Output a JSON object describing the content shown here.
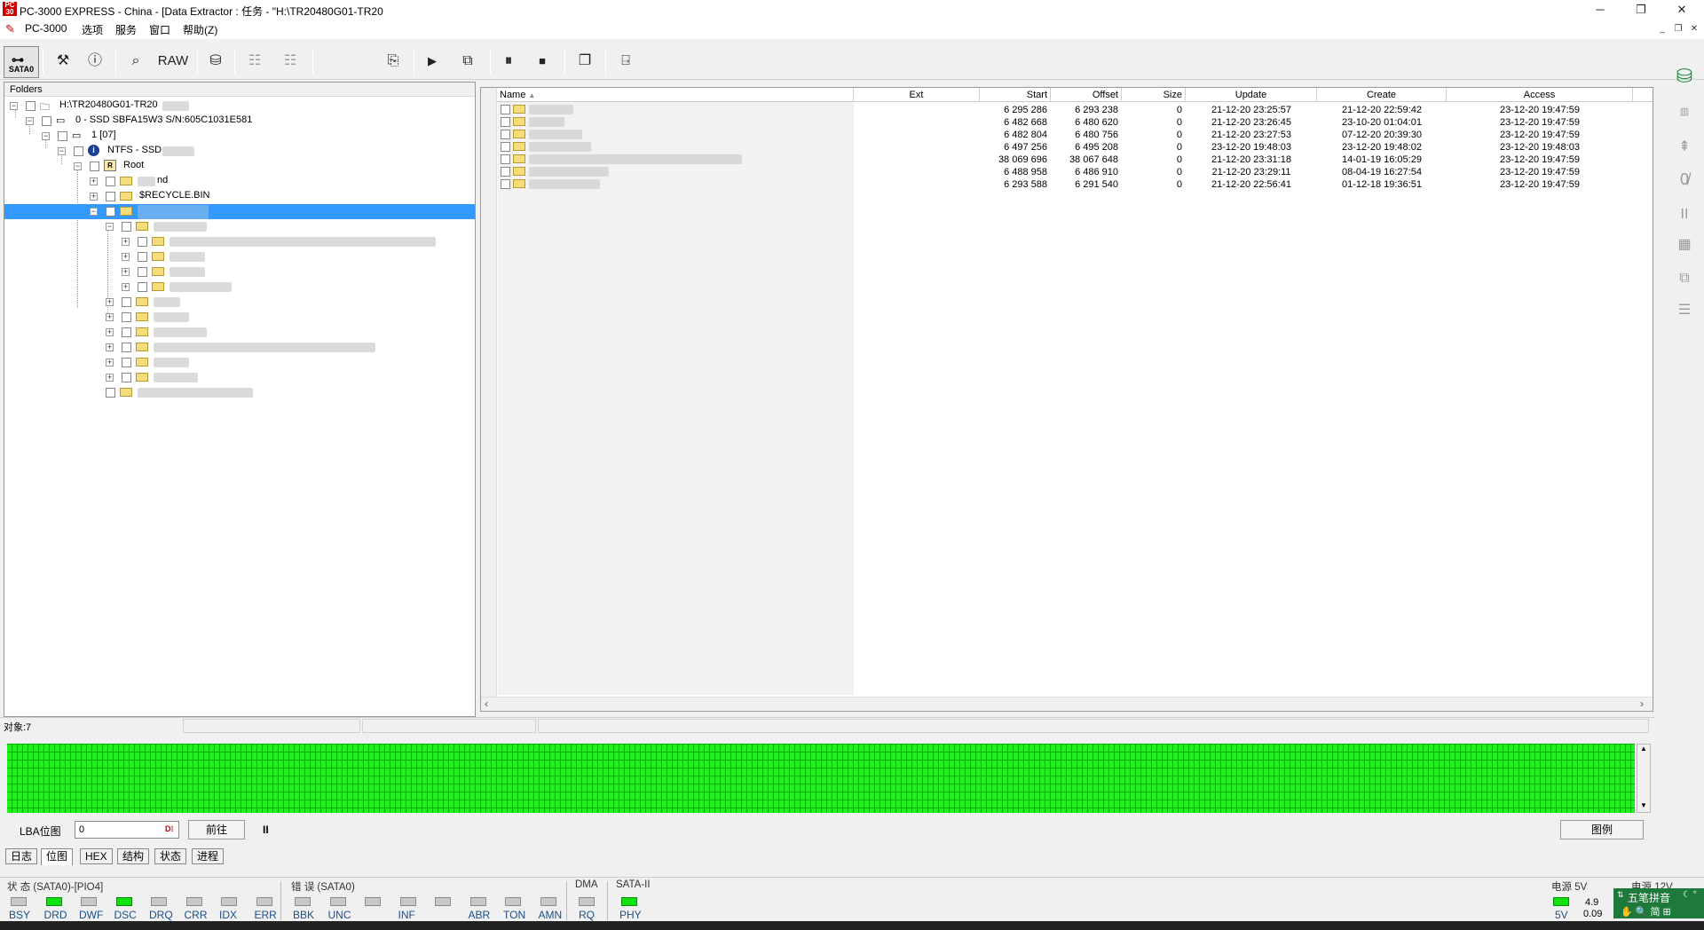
{
  "window": {
    "title": "PC-3000 EXPRESS - China - [Data Extractor : 任务 - \"H:\\TR20480G01-TR20",
    "controls": {
      "minimize": "─",
      "restore": "❐",
      "close": "✕"
    }
  },
  "menu": {
    "items": [
      "PC-3000",
      "选项",
      "服务",
      "窗口",
      "帮助(Z)"
    ],
    "mdi": {
      "minimize": "_",
      "restore": "❐",
      "close": "✕"
    }
  },
  "toolbar": {
    "sata_label": "SATA0",
    "raw_label": "RAW"
  },
  "tree": {
    "header": "Folders",
    "nodes": {
      "task": "H:\\TR20480G01-TR20",
      "device": "0 - SSD SBFA15W3 S/N:605C1031E581",
      "partition": "1 [07]",
      "fs": "NTFS - SSD",
      "root": "Root",
      "child1": "nd",
      "child2": "$RECYCLE.BIN"
    }
  },
  "list": {
    "columns": [
      "Name",
      "Ext",
      "Start",
      "Offset",
      "Size",
      "Update",
      "Create",
      "Access"
    ],
    "rows": [
      {
        "start": "6 295 286",
        "offset": "6 293 238",
        "size": "0",
        "update": "21-12-20 23:25:57",
        "create": "21-12-20 22:59:42",
        "access": "23-12-20 19:47:59"
      },
      {
        "start": "6 482 668",
        "offset": "6 480 620",
        "size": "0",
        "update": "21-12-20 23:26:45",
        "create": "23-10-20 01:04:01",
        "access": "23-12-20 19:47:59"
      },
      {
        "start": "6 482 804",
        "offset": "6 480 756",
        "size": "0",
        "update": "21-12-20 23:27:53",
        "create": "07-12-20 20:39:30",
        "access": "23-12-20 19:47:59"
      },
      {
        "start": "6 497 256",
        "offset": "6 495 208",
        "size": "0",
        "update": "23-12-20 19:48:03",
        "create": "23-12-20 19:48:02",
        "access": "23-12-20 19:48:03"
      },
      {
        "start": "38 069 696",
        "offset": "38 067 648",
        "size": "0",
        "update": "21-12-20 23:31:18",
        "create": "14-01-19 16:05:29",
        "access": "23-12-20 19:47:59"
      },
      {
        "start": "6 488 958",
        "offset": "6 486 910",
        "size": "0",
        "update": "21-12-20 23:29:11",
        "create": "08-04-19 16:27:54",
        "access": "23-12-20 19:47:59"
      },
      {
        "start": "6 293 588",
        "offset": "6 291 540",
        "size": "0",
        "update": "21-12-20 22:56:41",
        "create": "01-12-18 19:36:51",
        "access": "23-12-20 19:47:59"
      }
    ]
  },
  "objects_status": "对象:7",
  "lba": {
    "label": "LBA位图",
    "value": "0",
    "goto_label": "前往",
    "pause_label": "II",
    "legend_label": "图例"
  },
  "tabs": [
    "日志",
    "位图",
    "HEX",
    "结构",
    "状态",
    "进程"
  ],
  "active_tab": "位图",
  "status": {
    "state_title": "状 态 (SATA0)-[PIO4]",
    "state_leds": [
      {
        "label": "BSY",
        "on": false
      },
      {
        "label": "DRD",
        "on": true
      },
      {
        "label": "DWF",
        "on": false
      },
      {
        "label": "DSC",
        "on": true
      },
      {
        "label": "DRQ",
        "on": false
      },
      {
        "label": "CRR",
        "on": false
      },
      {
        "label": "IDX",
        "on": false
      },
      {
        "label": "ERR",
        "on": false
      }
    ],
    "error_title": "错 误 (SATA0)",
    "error_leds": [
      "BBK",
      "UNC",
      "",
      "INF",
      "",
      "ABR",
      "TON",
      "AMN"
    ],
    "dma_title": "DMA",
    "dma_led": "RQ",
    "sata_title": "SATA-II",
    "sata_led": "PHY",
    "power5_title": "电源 5V",
    "power5_led": "5V",
    "power5_voltage": "4.9",
    "power5_current": "0.09",
    "power12_title": "电源 12V"
  },
  "ime": {
    "name": "五笔拼音",
    "icons": "✋ 🔍 简 ⊞"
  },
  "colors": {
    "selection": "#3399ff",
    "led_on": "#10e010",
    "bitmap_green": "#22ee22",
    "led_label": "#1a4f8a"
  }
}
